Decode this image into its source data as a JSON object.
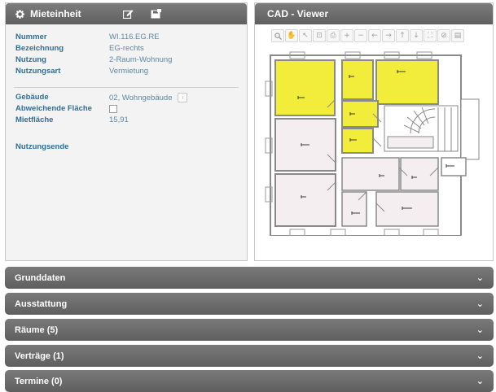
{
  "mieteinheit": {
    "title": "Mieteinheit",
    "fields": [
      {
        "label": "Nummer",
        "value": "WI.116.EG.RE"
      },
      {
        "label": "Bezeichnung",
        "value": "EG-rechts"
      },
      {
        "label": "Nutzung",
        "value": "2-Raum-Wohnung"
      },
      {
        "label": "Nutzungsart",
        "value": "Vermietung"
      }
    ],
    "gebaeude": {
      "label": "Gebäude",
      "value": "02, Wohngebäude"
    },
    "abweichende_flaeche": {
      "label": "Abweichende Fläche",
      "checked": false
    },
    "mietflaeche": {
      "label": "Mietfläche",
      "value": "15,91"
    },
    "nutzungsende": {
      "label": "Nutzungsende",
      "value": ""
    }
  },
  "cad_viewer": {
    "title": "CAD - Viewer",
    "tools": [
      "zoom-icon",
      "pan-hand-icon",
      "select-arrow-icon",
      "zoom-window-icon",
      "print-icon",
      "zoom-in-icon",
      "zoom-out-icon",
      "pan-left-icon",
      "pan-right-icon",
      "pan-up-icon",
      "pan-down-icon",
      "fit-extent-icon",
      "reset-icon",
      "document-icon"
    ],
    "highlight_color": "#f2ec3a",
    "wall_color": "#8a8a8a",
    "room_color": "#f5eef0"
  },
  "sections": [
    {
      "label": "Grunddaten"
    },
    {
      "label": "Ausstattung"
    },
    {
      "label": "Räume (5)"
    },
    {
      "label": "Verträge (1)"
    },
    {
      "label": "Termine (0)"
    }
  ]
}
